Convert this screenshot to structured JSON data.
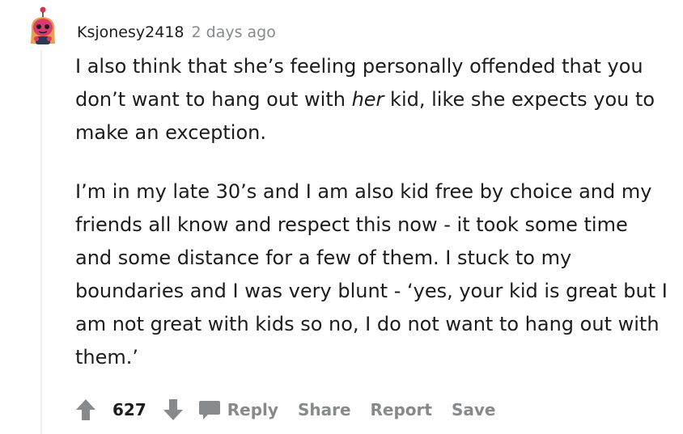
{
  "comment": {
    "author": "Ksjonesy2418",
    "timestamp": "2 days ago",
    "paragraph1_pre": "I also think that she’s feeling personally offended that you don’t want to hang out with ",
    "paragraph1_em": "her",
    "paragraph1_post": " kid, like she expects you to make an exception.",
    "paragraph2": "I’m in my late 30’s and I am also kid free by choice and my friends all know and respect this now - it took some time and some distance for a few of them. I stuck to my boundaries and I was very blunt - ‘yes, your kid is great but I am not great with kids so no, I do not want to hang out with them.’",
    "score": "627"
  },
  "actions": {
    "reply": "Reply",
    "share": "Share",
    "report": "Report",
    "save": "Save"
  },
  "icons": {
    "avatar": "snoo-avatar-icon",
    "upvote": "upvote-arrow-icon",
    "downvote": "downvote-arrow-icon",
    "comment": "speech-bubble-icon"
  },
  "colors": {
    "text": "#1c1c1c",
    "muted": "#878a8c",
    "thread_line": "#edeff1",
    "avatar_body": "#d93a6f",
    "avatar_hair": "#e8a04a"
  }
}
